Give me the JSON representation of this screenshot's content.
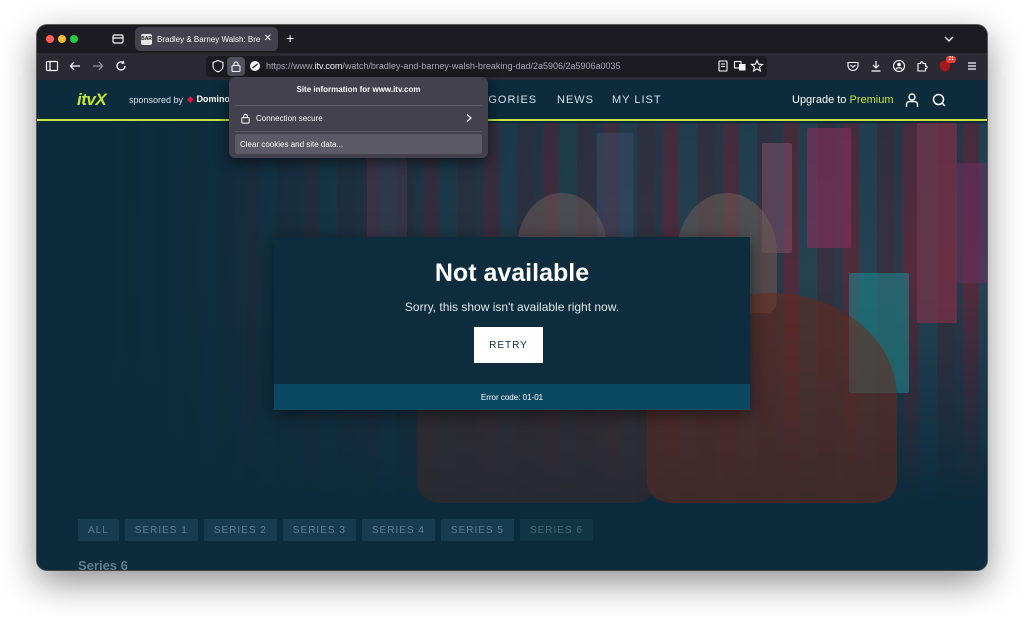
{
  "browser": {
    "tab": {
      "title": "Bradley & Barney Walsh: Breaking Dad",
      "favicon_text": "BAR"
    },
    "url": {
      "prefix": "https://www.",
      "domain": "itv.com",
      "path": "/watch/bradley-and-barney-walsh-breaking-dad/2a5906/2a5906a0035"
    },
    "extensions_badge": "21"
  },
  "popup": {
    "title": "Site information for www.itv.com",
    "connection": "Connection secure",
    "clear": "Clear cookies and site data..."
  },
  "site": {
    "logo": "itvX",
    "sponsor": "sponsored by",
    "sponsor_brand": "Domino",
    "nav": [
      "EGORIES",
      "NEWS",
      "MY LIST"
    ],
    "upgrade_prefix": "Upgrade to ",
    "upgrade_premium": "Premium"
  },
  "modal": {
    "title": "Not available",
    "message": "Sorry, this show isn't available right now.",
    "retry": "RETRY",
    "error": "Error code: 01-01"
  },
  "series": {
    "tabs": [
      "ALL",
      "SERIES 1",
      "SERIES 2",
      "SERIES 3",
      "SERIES 4",
      "SERIES 5",
      "SERIES 6"
    ],
    "heading": "Series 6"
  },
  "colors": {
    "accent": "#c3e53b",
    "page_bg": "#0c2b3c",
    "error_bar": "#0a4862"
  }
}
